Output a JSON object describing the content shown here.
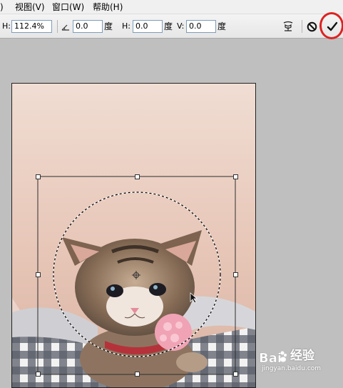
{
  "menu": {
    "partial_item": ")",
    "items": [
      "视图(V)",
      "窗口(W)",
      "帮助(H)"
    ]
  },
  "options_bar": {
    "width_label": "H:",
    "width_value": "112.4%",
    "rotate_icon": "angle-icon",
    "rotate_value": "0.0",
    "rotate_unit": "度",
    "h_skew_label": "H:",
    "h_skew_value": "0.0",
    "h_skew_unit": "度",
    "v_skew_label": "V:",
    "v_skew_value": "0.0",
    "v_skew_unit": "度",
    "warp_icon": "warp-icon",
    "cancel_icon": "cancel-icon",
    "commit_icon": "checkmark-icon"
  },
  "canvas": {
    "subject": "kitten photo",
    "selection": "elliptical marquee",
    "transform": "bounding box with handles"
  },
  "watermark": {
    "brand": "经验",
    "url": "jingyan.baidu.com"
  },
  "colors": {
    "highlight_ring": "#d22222",
    "menu_bg": "#f0f0f0",
    "workspace_bg": "#bfbfbf"
  }
}
